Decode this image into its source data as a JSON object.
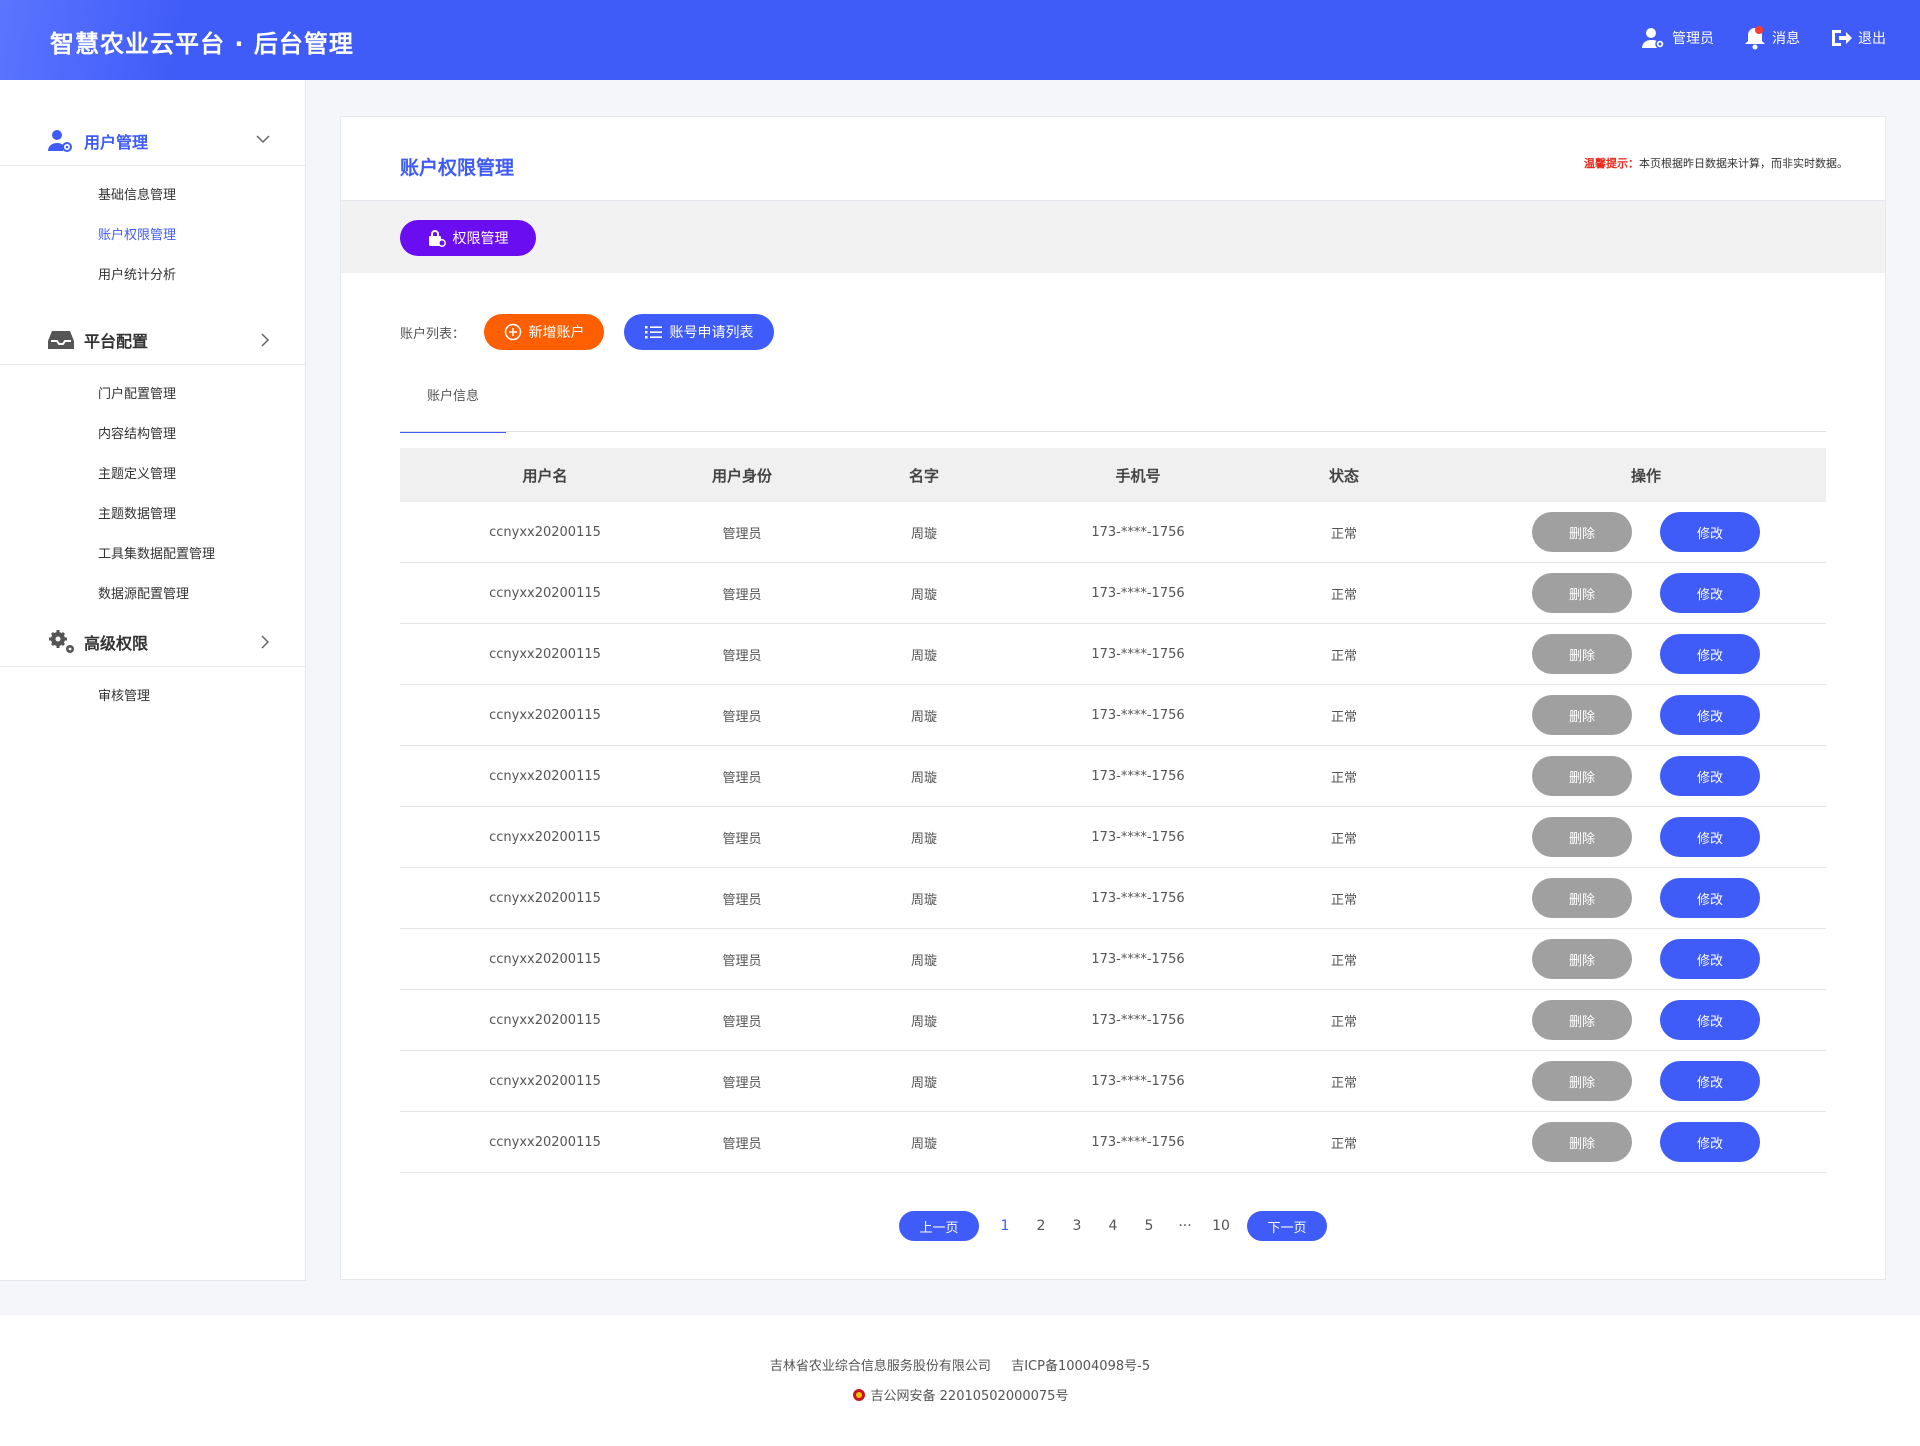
{
  "header": {
    "brand": "智慧农业云平台 · 后台管理",
    "admin_label": "管理员",
    "message_label": "消息",
    "logout_label": "退出"
  },
  "sidebar": {
    "groups": [
      {
        "title": "用户管理",
        "icon": "user-gear-icon",
        "items": [
          "基础信息管理",
          "账户权限管理",
          "用户统计分析"
        ]
      },
      {
        "title": "平台配置",
        "icon": "inbox-icon",
        "items": [
          "门户配置管理",
          "内容结构管理",
          "主题定义管理",
          "主题数据管理",
          "工具集数据配置管理",
          "数据源配置管理"
        ]
      },
      {
        "title": "高级权限",
        "icon": "gears-icon",
        "items": [
          "审核管理"
        ]
      }
    ],
    "active_item": "账户权限管理"
  },
  "main": {
    "title": "账户权限管理",
    "hint_label": "温馨提示：",
    "hint_text": "本页根据昨日数据来计算，而非实时数据。",
    "perm_button": "权限管理",
    "list_label": "账户列表：",
    "add_button": "新增账户",
    "apply_button": "账号申请列表",
    "tab": "账户信息"
  },
  "table": {
    "headers": [
      "用户名",
      "用户身份",
      "名字",
      "手机号",
      "状态",
      "操作"
    ],
    "rows": [
      [
        "ccnyxx20200115",
        "管理员",
        "周璇",
        "173-****-1756",
        "正常"
      ],
      [
        "ccnyxx20200115",
        "管理员",
        "周璇",
        "173-****-1756",
        "正常"
      ],
      [
        "ccnyxx20200115",
        "管理员",
        "周璇",
        "173-****-1756",
        "正常"
      ],
      [
        "ccnyxx20200115",
        "管理员",
        "周璇",
        "173-****-1756",
        "正常"
      ],
      [
        "ccnyxx20200115",
        "管理员",
        "周璇",
        "173-****-1756",
        "正常"
      ],
      [
        "ccnyxx20200115",
        "管理员",
        "周璇",
        "173-****-1756",
        "正常"
      ],
      [
        "ccnyxx20200115",
        "管理员",
        "周璇",
        "173-****-1756",
        "正常"
      ],
      [
        "ccnyxx20200115",
        "管理员",
        "周璇",
        "173-****-1756",
        "正常"
      ],
      [
        "ccnyxx20200115",
        "管理员",
        "周璇",
        "173-****-1756",
        "正常"
      ],
      [
        "ccnyxx20200115",
        "管理员",
        "周璇",
        "173-****-1756",
        "正常"
      ],
      [
        "ccnyxx20200115",
        "管理员",
        "周璇",
        "173-****-1756",
        "正常"
      ]
    ],
    "delete_label": "删除",
    "edit_label": "修改"
  },
  "pagination": {
    "prev": "上一页",
    "pages": [
      "1",
      "2",
      "3",
      "4",
      "5",
      "···",
      "10"
    ],
    "current": "1",
    "next": "下一页"
  },
  "footer": {
    "company": "吉林省农业综合信息服务股份有限公司",
    "icp": "吉ICP备10004098号-5",
    "police": "吉公网安备 22010502000075号"
  },
  "colors": {
    "primary": "#3f5bf8",
    "purple": "#6a0df0",
    "orange": "#ff5f00",
    "danger_text": "#e8291c",
    "delete_gray": "#a0a0a0"
  }
}
